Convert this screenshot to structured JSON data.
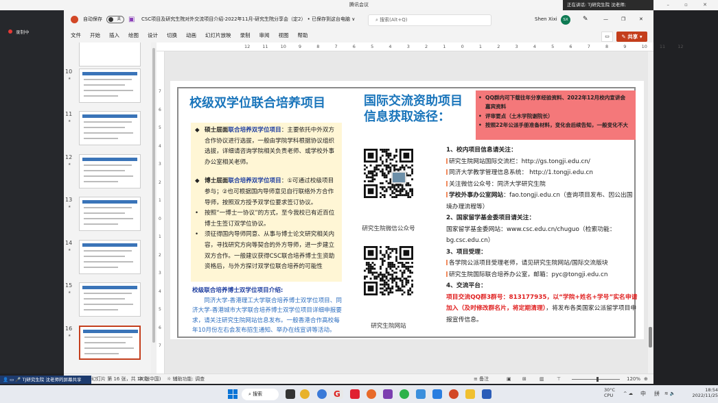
{
  "meeting": {
    "title": "腾讯会议",
    "speaking": "正在讲话: TJ研究生院 沈老师;",
    "recording": "录制中",
    "share_status": "TJ研究生院 沈老师的屏幕共享"
  },
  "ppt": {
    "autosave_label": "自动保存",
    "autosave_state": "关",
    "doc_title": "CSC项目及研究生院对外交流项目介绍-2022年11月-研究生院分享会（定2） • 已保存到这台电脑 ∨",
    "search_placeholder": "搜索(Alt+Q)",
    "user_name": "Shen Xixi",
    "user_initials": "SX",
    "menu": [
      "文件",
      "开始",
      "插入",
      "绘图",
      "设计",
      "切换",
      "动画",
      "幻灯片放映",
      "录制",
      "审阅",
      "视图",
      "帮助"
    ],
    "share_label": "共享",
    "ruler_h": [
      "12",
      "11",
      "10",
      "9",
      "8",
      "7",
      "6",
      "5",
      "4",
      "3",
      "2",
      "1",
      "0",
      "1",
      "2",
      "3",
      "4",
      "5",
      "6",
      "7",
      "8",
      "9",
      "10",
      "11",
      "12"
    ],
    "ruler_v": [
      "7",
      "6",
      "5",
      "4",
      "3",
      "2",
      "1",
      "0",
      "1",
      "2",
      "3",
      "4",
      "5",
      "6",
      "7"
    ],
    "thumbnails": [
      {
        "num": "10"
      },
      {
        "num": "11"
      },
      {
        "num": "12"
      },
      {
        "num": "13"
      },
      {
        "num": "14"
      },
      {
        "num": "15"
      },
      {
        "num": "16",
        "selected": true
      }
    ],
    "status": {
      "slide_info": "幻灯片 第 16 张，共 16 张",
      "language": "中文(中国)",
      "accessibility": "辅助功能: 调查",
      "notes": "备注",
      "zoom": "120%"
    }
  },
  "slide": {
    "left_title": "校级双学位联合培养项目",
    "left_bullets": [
      {
        "bold": "硕士层面",
        "blue": "联合培养双学位项目",
        "text": "：主要依托中外双方合作协议进行选拔，一般由学院学科根据协议组织选拔，详细请咨询学院相关负责老师、或学校外事办公室相关老师。"
      },
      {
        "bold": "博士层面",
        "blue": "联合培养双学位项目",
        "text": "：①可通过校级项目参与；②也可根据国内导师意见自行联络外方合作导师，按照双方授予双学位要求签订协议。"
      }
    ],
    "left_sub_bullets": [
      "按照“一博士一协议”的方式，至今我校已有近百位博士生签订双学位协议。",
      "须征得国内导师同意、从事与博士论文研究相关内容，寻找研究方向等契合的外方导师，进一步建立双方合作。一般建议获得CSC联合培养博士生资助资格后，与外方探讨双学位联合培养的可能性"
    ],
    "left_bottom_title": "校级联合培养博士双学位项目介绍:",
    "left_bottom_text": "同济大学-香港理工大学联合培养博士双学位项目、同济大学-香港城市大学联合培养博士双学位项目详细申报要求，请关注研究生院网站信息发布。一般香港合作高校每年10月份左右会发布招生通知、举办在线宣讲等活动。",
    "right_title_1": "国际交流资助项目",
    "right_title_2": "信息获取途径：",
    "pink_notes": [
      "QQ群内可下载往年分享经验资料、2022年12月校内宣讲会嘉宾资料",
      "评审要点（土木学院谢院长）",
      "按照22年公派手册准备材料，变化会后续告知，一般变化不大"
    ],
    "qr1_label": "研究生院微信公众号",
    "qr2_label": "研究生院网站",
    "s1_head": "1、校内项目信息请关注：",
    "s1_items": [
      "研究生院网站国际交流栏：http://gs.tongji.edu.cn/",
      "同济大学教学管理信息系统： http://1.tongji.edu.cn",
      "关注微信公众号：同济大学研究生院"
    ],
    "s1_fao_bold": "学校外事办公室网站",
    "s1_fao_text": "：fao.tongji.edu.cn（查询项目发布、因公出国境办理流程等）",
    "s2_head": "2、国家留学基金委项目请关注：",
    "s2_text": "国家留学基金委网站：www.csc.edu.cn/chuguo（检索功能：bg.csc.edu.cn）",
    "s3_head": "3、项目受理：",
    "s3_items": [
      "各学院公派项目受理老师，请见研究生院网站/国际交流版块",
      "研究生院国际联合培养办公室，邮箱：pyc@tongji.edu.cn"
    ],
    "s4_head": "4、交流平台：",
    "s4_red": "项目交流QQ群3群号：813177935，以“学院+姓名+学号”实名申请加入（及时修改群名片，将定期清理）",
    "s4_text": "，将发布各类国家公派留学项目申报宣传信息。"
  },
  "taskbar": {
    "search": "搜索",
    "temp": "30°C",
    "temp_label": "CPU",
    "ime": "中",
    "ime2": "拼",
    "time": "18:54",
    "date": "2022/11/25"
  },
  "colors": {
    "accent": "#c43e1c",
    "title_blue": "#1a75bb",
    "pink_box": "#f4787a",
    "highlight_red": "#e02020"
  }
}
